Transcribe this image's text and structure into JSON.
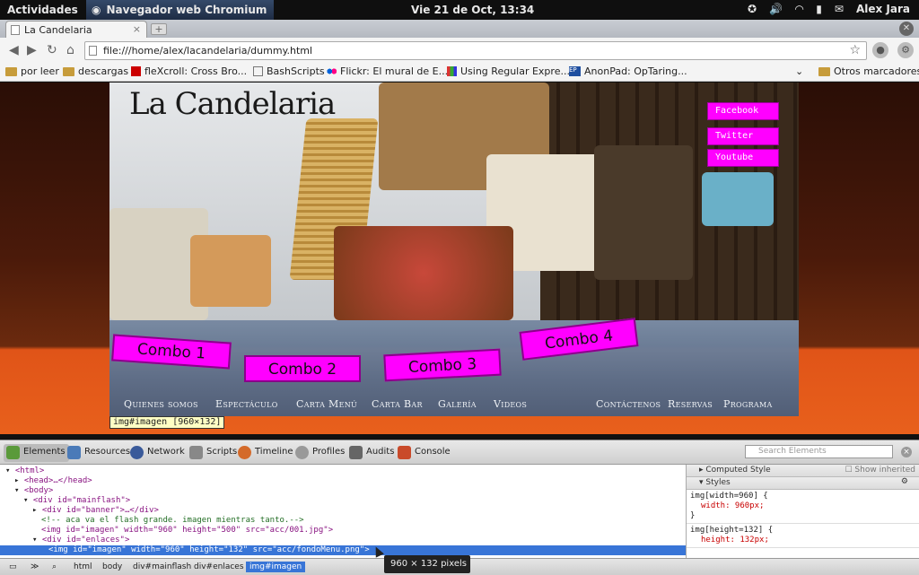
{
  "topbar": {
    "activities": "Actividades",
    "app": "Navegador web Chromium",
    "clock": "Vie 21 de Oct, 13:34",
    "user": "Alex Jara"
  },
  "browser": {
    "tab_title": "La Candelaria",
    "url": "file:///home/alex/lacandelaria/dummy.html"
  },
  "bookmarks": {
    "items": [
      "por leer",
      "descargas",
      "fleXcroll: Cross Bro...",
      "BashScripts",
      "Flickr: El mural de E...",
      "Using Regular Expre...",
      "AnonPad: OpTaring..."
    ],
    "other": "Otros marcadores"
  },
  "page": {
    "title": "La Candelaria",
    "social": [
      "Facebook",
      "Twitter",
      "Youtube"
    ],
    "combos": [
      "Combo 1",
      "Combo 2",
      "Combo 3",
      "Combo 4"
    ],
    "menu": [
      "Quienes somos",
      "Espectáculo",
      "Carta Menú",
      "Carta Bar",
      "Galería",
      "Videos",
      "Contáctenos",
      "Reservas",
      "Programa"
    ],
    "tooltip": "img#imagen [960×132]"
  },
  "devtools": {
    "tabs": [
      "Elements",
      "Resources",
      "Network",
      "Scripts",
      "Timeline",
      "Profiles",
      "Audits",
      "Console"
    ],
    "search_placeholder": "Search Elements",
    "lines": {
      "l1": "<html>",
      "l2": "<head>…</head>",
      "l3": "<body>",
      "l4": "<div id=\"mainflash\">",
      "l5": "<div id=\"banner\">…</div>",
      "l6": "<!-- aca va el flash grande. imagen mientras tanto.-->",
      "l7": "<img id=\"imagen\" width=\"960\" height=\"500\" src=\"acc/001.jpg\">",
      "l8": "<div id=\"enlaces\">",
      "l9": "<img id=\"imagen\" width=\"960\" height=\"132\" src=\"acc/fondoMenu.png\">"
    },
    "sidebar": {
      "computed": "Computed Style",
      "show_inherited": "Show inherited",
      "styles": "Styles",
      "rule1_sel": "img[width=960] {",
      "rule1_prop": "width: 960px;",
      "rule2_sel": "img[height=132] {",
      "rule2_prop": "height: 132px;",
      "close": "}"
    },
    "breadcrumbs": [
      "html",
      "body",
      "div#mainflash",
      "div#enlaces",
      "img#imagen"
    ],
    "size_tooltip": "960 × 132 pixels"
  },
  "colors": {
    "accent": "#ff00ff",
    "selection": "#3875d7"
  }
}
